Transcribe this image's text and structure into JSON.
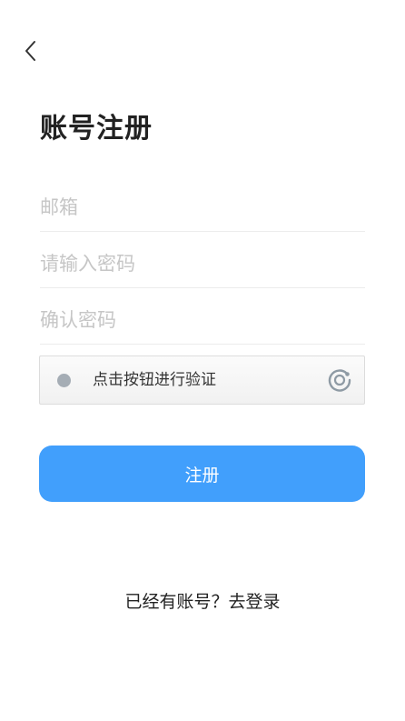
{
  "header": {
    "back_icon": "chevron-left-icon"
  },
  "title": "账号注册",
  "form": {
    "email": {
      "value": "",
      "placeholder": "邮箱"
    },
    "password": {
      "value": "",
      "placeholder": "请输入密码"
    },
    "confirm_password": {
      "value": "",
      "placeholder": "确认密码"
    }
  },
  "captcha": {
    "label": "点击按钮进行验证",
    "status_icon": "captcha-dot-icon",
    "logo_icon": "captcha-logo-icon",
    "dot_color": "#a5adb5",
    "logo_color": "#8e9aa4"
  },
  "submit": {
    "label": "注册",
    "color": "#419ffc"
  },
  "footer": {
    "login_link": "已经有账号？去登录"
  }
}
